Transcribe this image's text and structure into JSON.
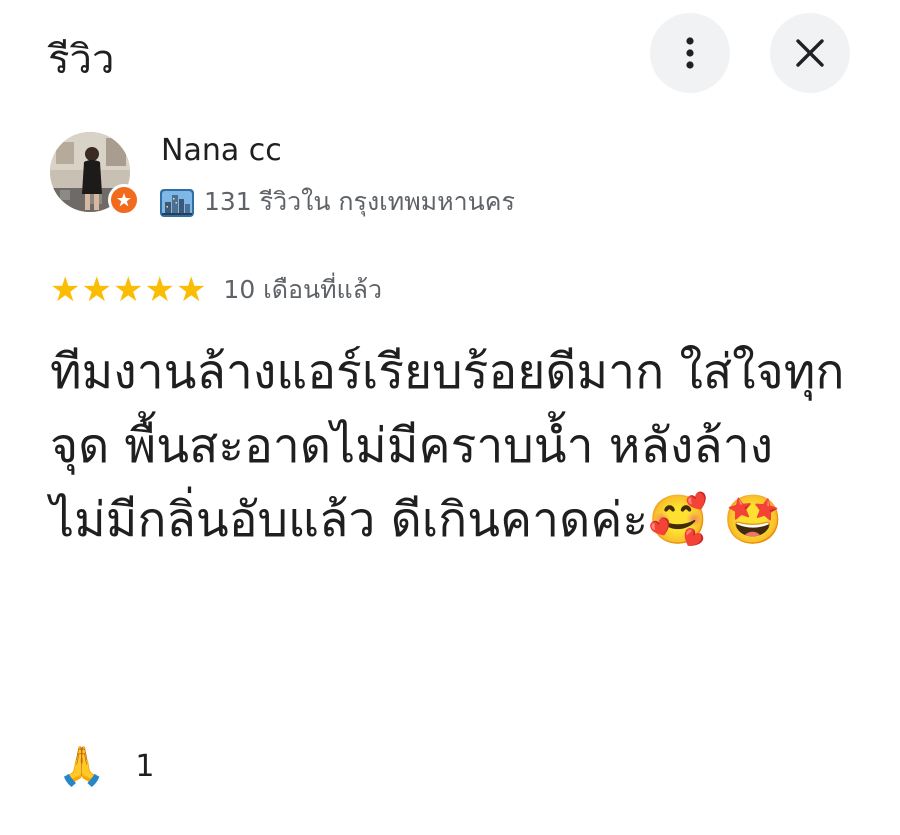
{
  "header": {
    "title": "รีวิว",
    "more_icon": "more-vert-icon",
    "close_icon": "close-icon"
  },
  "reviewer": {
    "name": "Nana cc",
    "meta": "131 รีวิวใน กรุงเทพมหานคร",
    "city_icon": "cityscape-icon",
    "badge_icon": "local-guide-badge-icon",
    "badge_color": "#f26b1d"
  },
  "rating": {
    "stars": [
      "★",
      "★",
      "★",
      "★",
      "★"
    ],
    "value": 5,
    "max": 5,
    "time": "10 เดือนที่แล้ว",
    "color": "#fbbc04"
  },
  "review": {
    "text": "ทีมงานล้างแอร์เรียบร้อยดีมาก ใส่ใจทุกจุด พื้นสะอาดไม่มีคราบน้ำ หลังล้างไม่มีกลิ่นอับแล้ว ดีเกินคาดค่ะ🥰 🤩"
  },
  "reaction": {
    "emoji": "🙏",
    "count": "1"
  }
}
